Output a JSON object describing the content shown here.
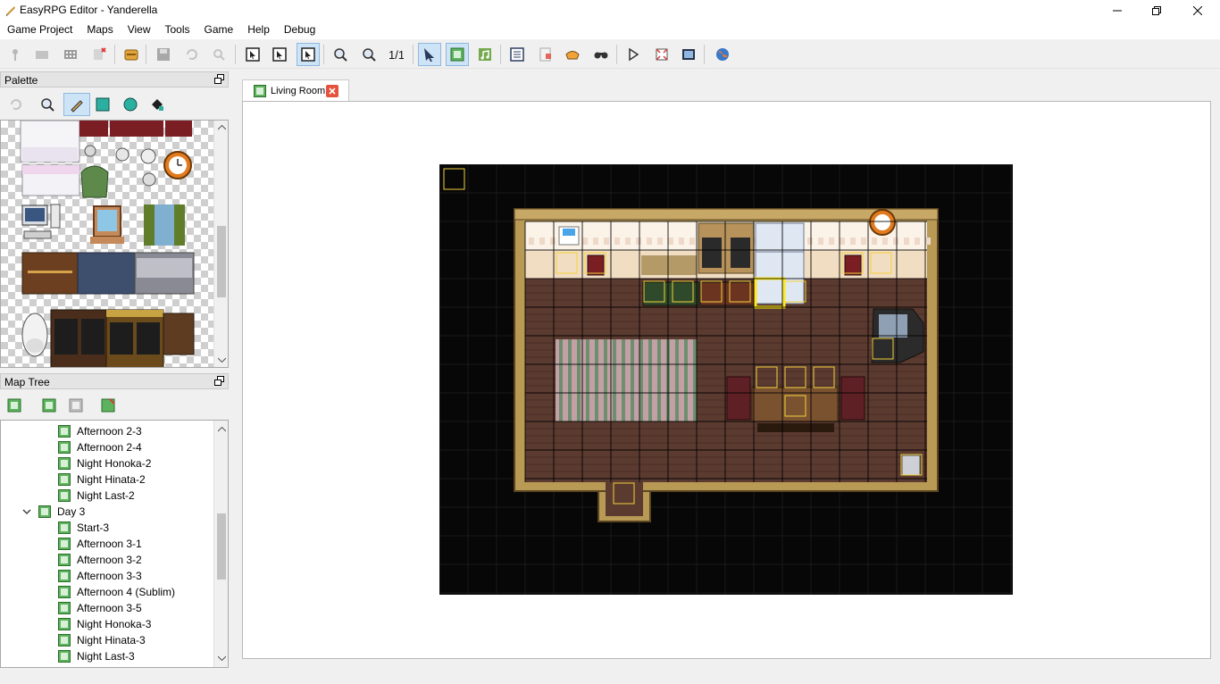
{
  "window": {
    "title": "EasyRPG Editor - Yanderella",
    "minimize_icon": "minimize-icon",
    "maximize_icon": "restore-icon",
    "close_icon": "close-icon"
  },
  "menu": [
    "Game Project",
    "Maps",
    "View",
    "Tools",
    "Game",
    "Help",
    "Debug"
  ],
  "toolbar": {
    "icons": [
      "new-project-icon",
      "open-project-icon",
      "close-project-icon",
      "revert-icon",
      "open-database-icon",
      "save-icon",
      "undo-icon",
      "zoom-disabled-icon",
      "layer-lower-icon",
      "layer-upper-icon",
      "layer-events-icon",
      "zoom-in-icon",
      "zoom-out-icon",
      "zoom-1-1-icon",
      "select-icon",
      "pencil-map-icon",
      "music-icon",
      "script-icon",
      "material-icon",
      "resource-icon",
      "search-icon",
      "play-icon",
      "fullscreen-icon",
      "title-icon",
      "globe-icon"
    ]
  },
  "palette": {
    "title": "Palette",
    "tools": [
      "undo-icon",
      "zoom-icon",
      "pen-icon",
      "rectangle-icon",
      "circle-icon",
      "fill-icon"
    ]
  },
  "maptree": {
    "title": "Map Tree",
    "tools": [
      "new-map-icon",
      "map-properties-icon",
      "delete-map-icon",
      "import-map-icon"
    ],
    "items": [
      {
        "label": "Afternoon 2-3",
        "level": 2
      },
      {
        "label": "Afternoon 2-4",
        "level": 2
      },
      {
        "label": "Night Honoka-2",
        "level": 2
      },
      {
        "label": "Night Hinata-2",
        "level": 2
      },
      {
        "label": "Night Last-2",
        "level": 2
      },
      {
        "label": "Day 3",
        "level": 1,
        "expanded": true
      },
      {
        "label": "Start-3",
        "level": 2
      },
      {
        "label": "Afternoon 3-1",
        "level": 2
      },
      {
        "label": "Afternoon 3-2",
        "level": 2
      },
      {
        "label": "Afternoon 3-3",
        "level": 2
      },
      {
        "label": "Afternoon 4 (Sublim)",
        "level": 2
      },
      {
        "label": "Afternoon 3-5",
        "level": 2
      },
      {
        "label": "Night Honoka-3",
        "level": 2
      },
      {
        "label": "Night Hinata-3",
        "level": 2
      },
      {
        "label": "Night Last-3",
        "level": 2
      }
    ]
  },
  "editor": {
    "tab_label": "Living Room",
    "tab_close_icon": "tab-close-icon"
  },
  "colors": {
    "accent": "#cde4f7",
    "map_background": "#070707",
    "floor": "#5b3a30",
    "wall": "#fbf3e8",
    "event_border": "#f2d13b"
  }
}
